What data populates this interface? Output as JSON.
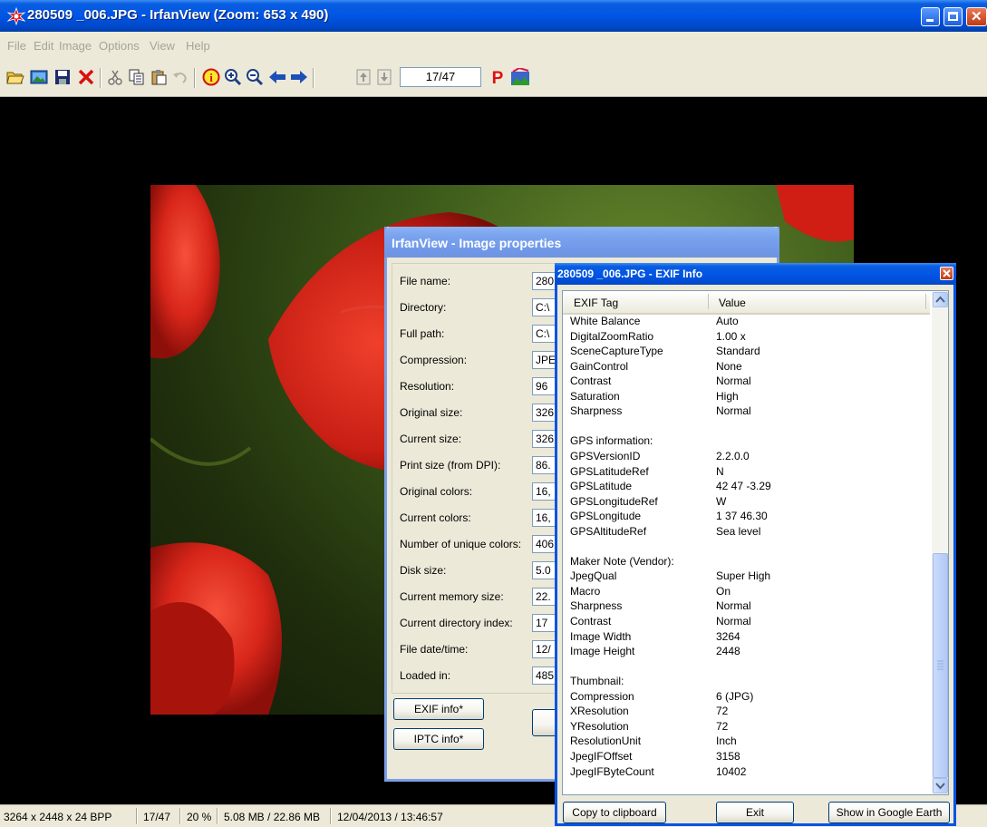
{
  "window": {
    "title": "280509 _006.JPG - IrfanView (Zoom: 653 x 490)",
    "accent_color": "#0055e5"
  },
  "menu": [
    "File",
    "Edit",
    "Image",
    "Options",
    "View",
    "Help"
  ],
  "toolbar": {
    "icons": [
      "open-icon",
      "slideshow-icon",
      "save-icon",
      "delete-icon",
      "cut-icon",
      "copy-icon",
      "paste-icon",
      "undo-icon",
      "info-icon",
      "zoom-in-icon",
      "zoom-out-icon",
      "prev-arrow-icon",
      "next-arrow-icon",
      "first-file-icon",
      "last-file-icon",
      "print-icon",
      "paint-icon"
    ],
    "page_counter": "17/47"
  },
  "status": {
    "dimensions": "3264 x 2448 x 24 BPP",
    "index": "17/47",
    "zoom": "20 %",
    "size": "5.08 MB / 22.86 MB",
    "date": "12/04/2013 / 13:46:57"
  },
  "properties_dialog": {
    "title": "IrfanView - Image properties",
    "rows": [
      {
        "label": "File name:",
        "value": "280"
      },
      {
        "label": "Directory:",
        "value": "C:\\"
      },
      {
        "label": "Full path:",
        "value": "C:\\"
      },
      {
        "label": "Compression:",
        "value": "JPE"
      },
      {
        "label": "Resolution:",
        "value": "96"
      },
      {
        "label": "Original size:",
        "value": "326"
      },
      {
        "label": "Current size:",
        "value": "326"
      },
      {
        "label": "Print size (from DPI):",
        "value": "86."
      },
      {
        "label": "Original colors:",
        "value": "16,"
      },
      {
        "label": "Current colors:",
        "value": "16,"
      },
      {
        "label": "Number of unique colors:",
        "value": "406"
      },
      {
        "label": "Disk size:",
        "value": "5.0"
      },
      {
        "label": "Current memory size:",
        "value": "22."
      },
      {
        "label": "Current directory index:",
        "value": "17"
      },
      {
        "label": "File date/time:",
        "value": "12/"
      },
      {
        "label": "Loaded in:",
        "value": "485"
      }
    ],
    "exif_button": "EXIF info*",
    "iptc_button": "IPTC info*"
  },
  "exif_dialog": {
    "title": "280509 _006.JPG - EXIF Info",
    "columns": [
      "EXIF Tag",
      "Value"
    ],
    "rows": [
      [
        "White Balance",
        "Auto"
      ],
      [
        "DigitalZoomRatio",
        "1.00 x"
      ],
      [
        "SceneCaptureType",
        "Standard"
      ],
      [
        "GainControl",
        "None"
      ],
      [
        "Contrast",
        "Normal"
      ],
      [
        "Saturation",
        "High"
      ],
      [
        "Sharpness",
        "Normal"
      ],
      [
        "",
        ""
      ],
      [
        "GPS information:",
        ""
      ],
      [
        "GPSVersionID",
        "2.2.0.0"
      ],
      [
        "GPSLatitudeRef",
        "N"
      ],
      [
        "GPSLatitude",
        "42  47  -3.29"
      ],
      [
        "GPSLongitudeRef",
        "W"
      ],
      [
        "GPSLongitude",
        "1  37  46.30"
      ],
      [
        "GPSAltitudeRef",
        "Sea level"
      ],
      [
        "",
        ""
      ],
      [
        "Maker Note (Vendor):",
        ""
      ],
      [
        "JpegQual",
        "Super High"
      ],
      [
        "Macro",
        "On"
      ],
      [
        "Sharpness",
        "Normal"
      ],
      [
        "Contrast",
        "Normal"
      ],
      [
        "Image Width",
        "3264"
      ],
      [
        "Image Height",
        "2448"
      ],
      [
        "",
        ""
      ],
      [
        "Thumbnail:",
        ""
      ],
      [
        "Compression",
        "6 (JPG)"
      ],
      [
        "XResolution",
        "72"
      ],
      [
        "YResolution",
        "72"
      ],
      [
        "ResolutionUnit",
        "Inch"
      ],
      [
        "JpegIFOffset",
        "3158"
      ],
      [
        "JpegIFByteCount",
        "10402"
      ]
    ],
    "copy_button": "Copy to clipboard",
    "exit_button": "Exit",
    "earth_button": "Show in Google Earth"
  }
}
